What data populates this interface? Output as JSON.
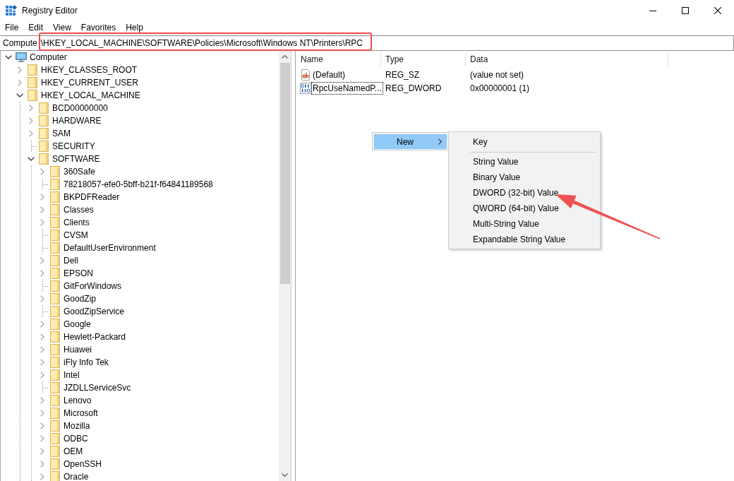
{
  "window": {
    "title": "Registry Editor"
  },
  "menu_bar": [
    "File",
    "Edit",
    "View",
    "Favorites",
    "Help"
  ],
  "address_bar": {
    "segments": [
      {
        "text": "Compute",
        "annotated": false
      },
      {
        "text": "\\HKEY_LOCAL_MACHINE\\SOFTWARE\\Policies\\Microsoft\\Windows NT\\Printers\\RPC",
        "annotated": true
      }
    ]
  },
  "tree": {
    "items": [
      {
        "label": "Computer",
        "kind": "computer",
        "expandable": true,
        "expanded": true,
        "children": [
          {
            "label": "HKEY_CLASSES_ROOT",
            "kind": "key",
            "expandable": true,
            "expanded": false
          },
          {
            "label": "HKEY_CURRENT_USER",
            "kind": "key",
            "expandable": true,
            "expanded": false
          },
          {
            "label": "HKEY_LOCAL_MACHINE",
            "kind": "key",
            "expandable": true,
            "expanded": true,
            "children": [
              {
                "label": "BCD00000000",
                "kind": "key",
                "expandable": true,
                "expanded": false
              },
              {
                "label": "HARDWARE",
                "kind": "key",
                "expandable": true,
                "expanded": false
              },
              {
                "label": "SAM",
                "kind": "key",
                "expandable": true,
                "expanded": false
              },
              {
                "label": "SECURITY",
                "kind": "key",
                "expandable": false
              },
              {
                "label": "SOFTWARE",
                "kind": "key",
                "expandable": true,
                "expanded": true,
                "children": [
                  {
                    "label": "360Safe",
                    "kind": "key",
                    "expandable": true,
                    "expanded": false
                  },
                  {
                    "label": "78218057-efe0-5bff-b21f-f64841189568",
                    "kind": "key",
                    "expandable": false
                  },
                  {
                    "label": "BKPDFReader",
                    "kind": "key",
                    "expandable": true,
                    "expanded": false
                  },
                  {
                    "label": "Classes",
                    "kind": "key",
                    "expandable": true,
                    "expanded": false
                  },
                  {
                    "label": "Clients",
                    "kind": "key",
                    "expandable": true,
                    "expanded": false
                  },
                  {
                    "label": "CVSM",
                    "kind": "key",
                    "expandable": false
                  },
                  {
                    "label": "DefaultUserEnvironment",
                    "kind": "key",
                    "expandable": false
                  },
                  {
                    "label": "Dell",
                    "kind": "key",
                    "expandable": true,
                    "expanded": false
                  },
                  {
                    "label": "EPSON",
                    "kind": "key",
                    "expandable": true,
                    "expanded": false
                  },
                  {
                    "label": "GitForWindows",
                    "kind": "key",
                    "expandable": false
                  },
                  {
                    "label": "GoodZip",
                    "kind": "key",
                    "expandable": true,
                    "expanded": false
                  },
                  {
                    "label": "GoodZipService",
                    "kind": "key",
                    "expandable": false
                  },
                  {
                    "label": "Google",
                    "kind": "key",
                    "expandable": true,
                    "expanded": false
                  },
                  {
                    "label": "Hewlett-Packard",
                    "kind": "key",
                    "expandable": true,
                    "expanded": false
                  },
                  {
                    "label": "Huawei",
                    "kind": "key",
                    "expandable": true,
                    "expanded": false
                  },
                  {
                    "label": "iFly Info Tek",
                    "kind": "key",
                    "expandable": true,
                    "expanded": false
                  },
                  {
                    "label": "Intel",
                    "kind": "key",
                    "expandable": true,
                    "expanded": false
                  },
                  {
                    "label": "JZDLLServiceSvc",
                    "kind": "key",
                    "expandable": false
                  },
                  {
                    "label": "Lenovo",
                    "kind": "key",
                    "expandable": true,
                    "expanded": false
                  },
                  {
                    "label": "Microsoft",
                    "kind": "key",
                    "expandable": true,
                    "expanded": false
                  },
                  {
                    "label": "Mozilla",
                    "kind": "key",
                    "expandable": true,
                    "expanded": false
                  },
                  {
                    "label": "ODBC",
                    "kind": "key",
                    "expandable": true,
                    "expanded": false
                  },
                  {
                    "label": "OEM",
                    "kind": "key",
                    "expandable": true,
                    "expanded": false
                  },
                  {
                    "label": "OpenSSH",
                    "kind": "key",
                    "expandable": true,
                    "expanded": false
                  },
                  {
                    "label": "Oracle",
                    "kind": "key",
                    "expandable": true,
                    "expanded": false
                  }
                ]
              }
            ]
          }
        ]
      }
    ]
  },
  "values_list": {
    "columns": [
      "Name",
      "Type",
      "Data"
    ],
    "rows": [
      {
        "kind": "string",
        "name": "(Default)",
        "type": "REG_SZ",
        "data": "(value not set)",
        "focused": false
      },
      {
        "kind": "dword",
        "name": "RpcUseNamedP...",
        "type": "REG_DWORD",
        "data": "0x00000001 (1)",
        "focused": true
      }
    ]
  },
  "context_menu": {
    "items": [
      {
        "label": "New",
        "selected": true,
        "has_submenu": true
      }
    ]
  },
  "submenu": {
    "items": [
      {
        "kind": "item",
        "label": "Key",
        "selected": false
      },
      {
        "kind": "separator"
      },
      {
        "kind": "item",
        "label": "String Value",
        "selected": false
      },
      {
        "kind": "item",
        "label": "Binary Value",
        "selected": false
      },
      {
        "kind": "item",
        "label": "DWORD (32-bit) Value",
        "selected": false
      },
      {
        "kind": "item",
        "label": "QWORD (64-bit) Value",
        "selected": false
      },
      {
        "kind": "item",
        "label": "Multi-String Value",
        "selected": false
      },
      {
        "kind": "item",
        "label": "Expandable String Value",
        "selected": false
      }
    ]
  }
}
